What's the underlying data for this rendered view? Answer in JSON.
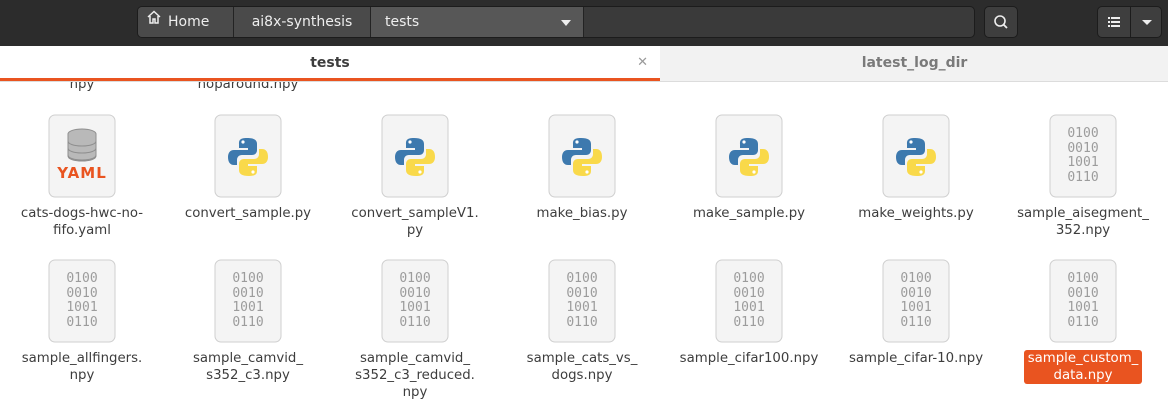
{
  "breadcrumbs": {
    "home": "Home",
    "parent": "ai8x-synthesis",
    "current": "tests"
  },
  "tabs": [
    {
      "label": "tests"
    },
    {
      "label": "latest_log_dir"
    }
  ],
  "top_partial": [
    "npy",
    "noparound.npy"
  ],
  "row1": [
    {
      "name": "cats-dogs-hwc-no-\nfifo.yaml",
      "icon": "yaml-icon",
      "yaml_text": "YAML"
    },
    {
      "name": "convert_sample.py",
      "icon": "python-icon"
    },
    {
      "name": "convert_sampleV1.\npy",
      "icon": "python-icon"
    },
    {
      "name": "make_bias.py",
      "icon": "python-icon"
    },
    {
      "name": "make_sample.py",
      "icon": "python-icon"
    },
    {
      "name": "make_weights.py",
      "icon": "python-icon"
    },
    {
      "name": "sample_aisegment_\n352.npy",
      "icon": "binary-icon"
    }
  ],
  "row2": [
    {
      "name": "sample_allfingers.\nnpy",
      "icon": "binary-icon"
    },
    {
      "name": "sample_camvid_\ns352_c3.npy",
      "icon": "binary-icon"
    },
    {
      "name": "sample_camvid_\ns352_c3_reduced.\nnpy",
      "icon": "binary-icon"
    },
    {
      "name": "sample_cats_vs_\ndogs.npy",
      "icon": "binary-icon"
    },
    {
      "name": "sample_cifar100.npy",
      "icon": "binary-icon"
    },
    {
      "name": "sample_cifar-10.npy",
      "icon": "binary-icon"
    },
    {
      "name": "sample_custom_\ndata.npy",
      "icon": "binary-icon",
      "selected": true
    }
  ],
  "binary_lines": [
    "0100",
    "0010",
    "1001",
    "0110"
  ],
  "colors": {
    "accent": "#e95420",
    "headerbar": "#2c2c2c",
    "python_blue": "#3d79ae",
    "python_yellow": "#f9d94a"
  }
}
